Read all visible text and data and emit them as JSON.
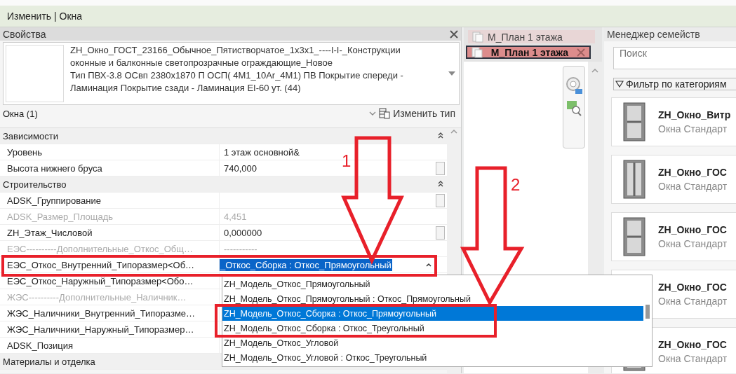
{
  "ribbon": {
    "context_label": "Изменить | Окна"
  },
  "properties": {
    "title": "Свойства",
    "type_selector": {
      "lines": [
        "ZH_Окно_ГОСТ_23166_Обычное_Пятистворчатое_1x3x1_----I-I-_Конструкции",
        "оконные и балконные светопрозрачные ограждающие_Новое",
        "Тип ПВХ-3.8 ОСвп 2380x1870 П ОСП( 4М1_10Ar_4М1) ПВ Покрытие спереди -",
        "Ламинация Покрытие сзади - Ламинация EI-60 ут. (44)"
      ]
    },
    "instance_filter": "Окна (1)",
    "edit_type_button": "Изменить тип",
    "rows": [
      {
        "kind": "group",
        "label": "Зависимости"
      },
      {
        "kind": "param",
        "label": "Уровень",
        "value": "1 этаж основной&",
        "disabled": false
      },
      {
        "kind": "param",
        "label": "Высота нижнего бруса",
        "value": "740,000",
        "disabled": false,
        "assoc_button": true
      },
      {
        "kind": "group",
        "label": "Строительство"
      },
      {
        "kind": "param",
        "label": "ADSK_Группирование",
        "disabled": false,
        "assoc_button": true
      },
      {
        "kind": "param",
        "label": "ADSK_Размер_Площадь",
        "value": "4,451",
        "disabled": true
      },
      {
        "kind": "param",
        "label": "ZH_Этаж_Числовой",
        "value": "0,000000",
        "disabled": false,
        "assoc_button": true
      },
      {
        "kind": "param",
        "label": "ЕЭС----------Дополнительные_Откос_Общ…",
        "value": "-----------",
        "disabled": true
      },
      {
        "kind": "editing",
        "label": "ЕЭС_Откос_Внутренний_Типоразмер<Об…",
        "value": "_Откос_Сборка : Откос_Прямоугольный",
        "disabled": false
      },
      {
        "kind": "param",
        "label": "ЕЭС_Откос_Наружный_Типоразмер<Обо…",
        "disabled": false
      },
      {
        "kind": "param",
        "label": "ЖЭС----------Дополнительные_Наличник…",
        "disabled": true
      },
      {
        "kind": "param",
        "label": "ЖЭС_Наличники_Внутренний_Типоразме…",
        "disabled": false
      },
      {
        "kind": "param",
        "label": "ЖЭС_Наличники_Наружный_Типоразмер…",
        "disabled": false
      },
      {
        "kind": "param",
        "label": "ADSK_Позиция",
        "disabled": false
      },
      {
        "kind": "group",
        "label": "Материалы и отделка"
      }
    ],
    "dropdown": {
      "items": [
        {
          "label": "ZH_Модель_Откос_Прямоугольный",
          "selected": false
        },
        {
          "label": "ZH_Модель_Откос_Прямоугольный : Откос_Прямоугольный",
          "selected": false
        },
        {
          "label": "ZH_Модель_Откос_Сборка : Откос_Прямоугольный",
          "selected": true
        },
        {
          "label": "ZH_Модель_Откос_Сборка : Откос_Треугольный",
          "selected": false
        },
        {
          "label": "ZH_Модель_Откос_Угловой",
          "selected": false
        },
        {
          "label": "ZH_Модель_Откос_Угловой : Откос_Треугольный",
          "selected": false
        }
      ]
    }
  },
  "view_tabs": [
    {
      "label": "М_План 1 этажа",
      "selected": false
    },
    {
      "label": "М_План 1 этажа",
      "selected": true
    }
  ],
  "family_manager": {
    "title": "Менеджер семейств",
    "search": {
      "placeholder": "Поиск"
    },
    "filter_button": "Фильтр по категориям",
    "families": [
      {
        "name": "ZH_Окно_Витр",
        "category": "Окна Стандарт"
      },
      {
        "name": "ZH_Окно_ГОС",
        "category": "Окна Стандарт"
      },
      {
        "name": "ZH_Окно_ГОС",
        "category": "Окна Стандарт"
      },
      {
        "name": "ZH_Окно_ГОС",
        "category": "Окна Стандарт"
      },
      {
        "name": "ZH_Окно_ГОС",
        "category": "Окна Стандарт"
      }
    ]
  },
  "annotations": [
    {
      "number": "1"
    },
    {
      "number": "2"
    }
  ]
}
